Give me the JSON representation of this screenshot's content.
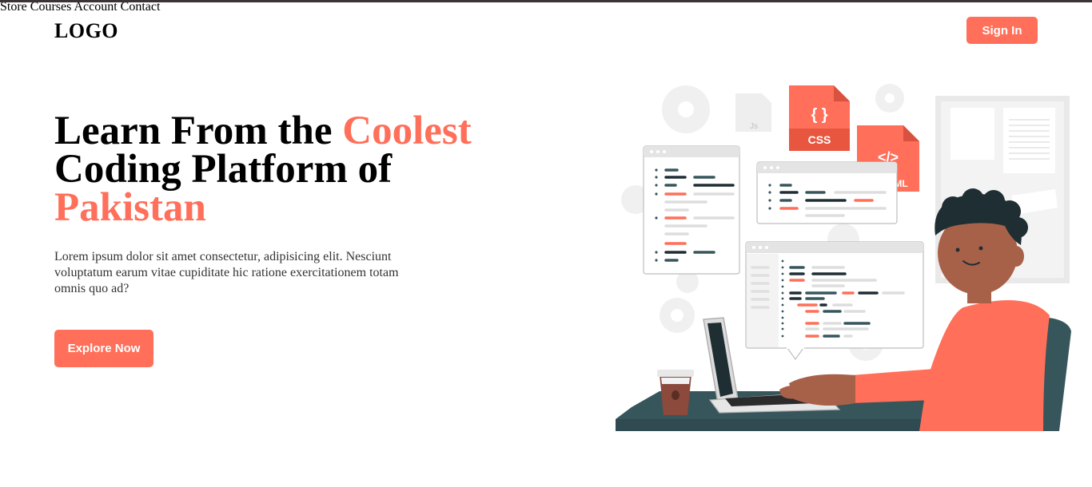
{
  "header": {
    "logo": "LOGO",
    "nav": [
      "Store",
      "Courses",
      "Account",
      "Contact"
    ],
    "signin_label": "Sign In"
  },
  "hero": {
    "title_part1": "Learn From the ",
    "title_accent1": "Coolest",
    "title_part2": "Coding Platform of",
    "title_accent2": "Pakistan",
    "description": "Lorem ipsum dolor sit amet consectetur, adipisicing elit. Nesciunt voluptatum earum vitae cupiditate hic ratione exercitationem totam omnis quo ad?",
    "cta_label": "Explore Now"
  },
  "illustration": {
    "css_badge": "CSS",
    "css_braces": "{ }",
    "html_badge": "</>",
    "html_badge_sub": "ML",
    "js_badge": "Js"
  },
  "colors": {
    "accent": "#ff6f59",
    "dark_teal": "#37565c",
    "top_border": "#3b3337"
  }
}
